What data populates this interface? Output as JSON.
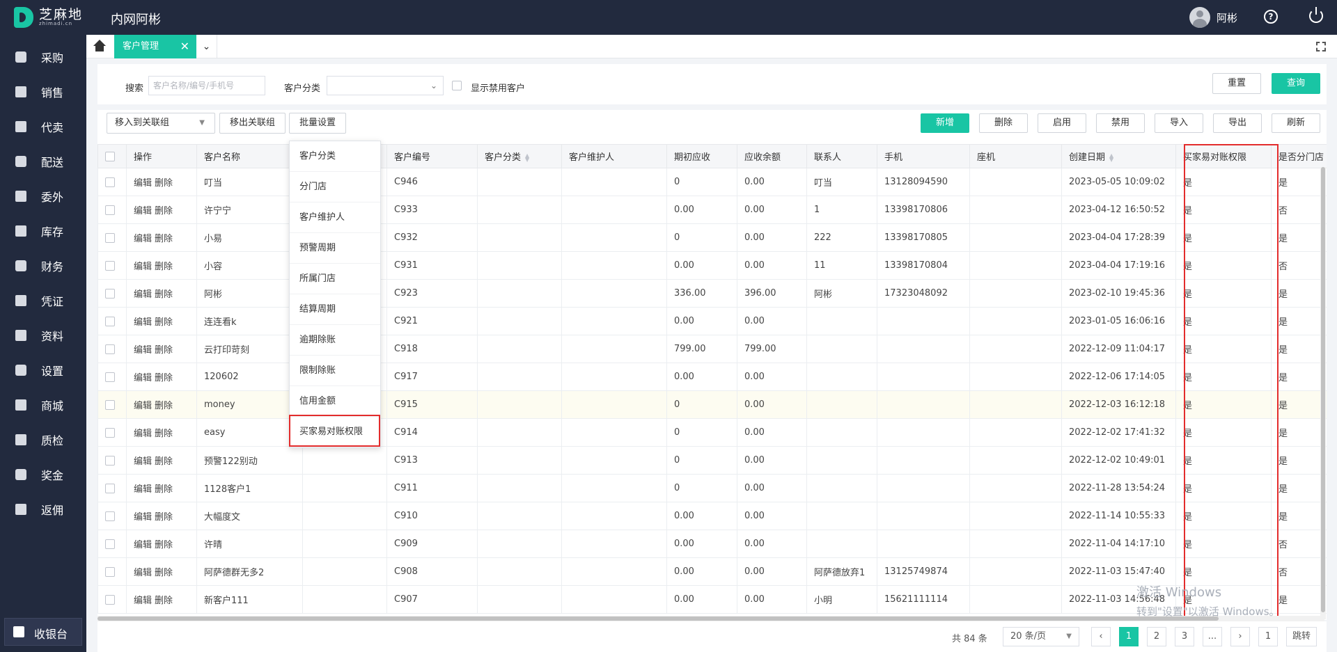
{
  "app": {
    "logo_main": "芝麻地",
    "logo_sub": "zhimadi.cn",
    "title": "内网阿彬",
    "user": "阿彬",
    "help": "?"
  },
  "sidebar": {
    "items": [
      {
        "label": "采购",
        "icon": "basket-icon"
      },
      {
        "label": "销售",
        "icon": "cart-icon"
      },
      {
        "label": "代卖",
        "icon": "tag-icon"
      },
      {
        "label": "配送",
        "icon": "truck-icon"
      },
      {
        "label": "委外",
        "icon": "building-icon"
      },
      {
        "label": "库存",
        "icon": "warehouse-icon"
      },
      {
        "label": "财务",
        "icon": "yen-icon"
      },
      {
        "label": "凭证",
        "icon": "voucher-icon"
      },
      {
        "label": "资料",
        "icon": "database-icon"
      },
      {
        "label": "设置",
        "icon": "gear-icon"
      },
      {
        "label": "商城",
        "icon": "store-icon"
      },
      {
        "label": "质检",
        "icon": "inspect-icon"
      },
      {
        "label": "奖金",
        "icon": "bonus-icon"
      },
      {
        "label": "返佣",
        "icon": "rebate-icon"
      }
    ],
    "checkout": "收银台"
  },
  "tabs": {
    "active": "客户管理",
    "close": "✕",
    "more": "⌄"
  },
  "filter": {
    "search_label": "搜索",
    "search_placeholder": "客户名称/编号/手机号",
    "category_label": "客户分类",
    "show_disabled": "显示禁用客户",
    "reset": "重置",
    "query": "查询"
  },
  "toolbar": {
    "move_to_group": "移入到关联组",
    "remove_from_group": "移出关联组",
    "batch_settings": "批量设置",
    "add": "新增",
    "delete": "删除",
    "enable": "启用",
    "disable": "禁用",
    "import": "导入",
    "export": "导出",
    "refresh": "刷新"
  },
  "batch_menu": [
    "客户分类",
    "分门店",
    "客户维护人",
    "预警周期",
    "所属门店",
    "结算周期",
    "逾期除账",
    "限制除账",
    "信用金额",
    "买家易对账权限"
  ],
  "table": {
    "headers": [
      "操作",
      "客户名称",
      "",
      "客户编号",
      "客户分类",
      "客户维护人",
      "期初应收",
      "应收余额",
      "联系人",
      "手机",
      "座机",
      "创建日期",
      "买家易对账权限",
      "是否分门店"
    ],
    "edit": "编辑",
    "del": "删除",
    "rows": [
      {
        "name": "叮当",
        "code": "C946",
        "init": "0",
        "balance": "0.00",
        "contact": "叮当",
        "phone": "13128094590",
        "date": "2023-05-05 10:09:02",
        "perm": "是",
        "branch": "是"
      },
      {
        "name": "许宁宁",
        "code": "C933",
        "init": "0.00",
        "balance": "0.00",
        "contact": "1",
        "phone": "13398170806",
        "date": "2023-04-12 16:50:52",
        "perm": "是",
        "branch": "否"
      },
      {
        "name": "小易",
        "code": "C932",
        "init": "0",
        "balance": "0.00",
        "contact": "222",
        "phone": "13398170805",
        "date": "2023-04-04 17:28:39",
        "perm": "是",
        "branch": "是"
      },
      {
        "name": "小容",
        "code": "C931",
        "init": "0.00",
        "balance": "0.00",
        "contact": "11",
        "phone": "13398170804",
        "date": "2023-04-04 17:19:16",
        "perm": "是",
        "branch": "否"
      },
      {
        "name": "阿彬",
        "code": "C923",
        "init": "336.00",
        "balance": "396.00",
        "contact": "阿彬",
        "phone": "17323048092",
        "date": "2023-02-10 19:45:36",
        "perm": "是",
        "branch": "是"
      },
      {
        "name": "连连看k",
        "code": "C921",
        "init": "0.00",
        "balance": "0.00",
        "contact": "",
        "phone": "",
        "date": "2023-01-05 16:06:16",
        "perm": "是",
        "branch": "是"
      },
      {
        "name": "云打印苛刻",
        "code": "C918",
        "init": "799.00",
        "balance": "799.00",
        "contact": "",
        "phone": "",
        "date": "2022-12-09 11:04:17",
        "perm": "是",
        "branch": "是"
      },
      {
        "name": "120602",
        "code": "C917",
        "init": "0.00",
        "balance": "0.00",
        "contact": "",
        "phone": "",
        "date": "2022-12-06 17:14:05",
        "perm": "是",
        "branch": "是"
      },
      {
        "name": "money",
        "code": "C915",
        "init": "0",
        "balance": "0.00",
        "contact": "",
        "phone": "",
        "date": "2022-12-03 16:12:18",
        "perm": "是",
        "branch": "是"
      },
      {
        "name": "easy",
        "code": "C914",
        "init": "0",
        "balance": "0.00",
        "contact": "",
        "phone": "",
        "date": "2022-12-02 17:41:32",
        "perm": "是",
        "branch": "是"
      },
      {
        "name": "预警122别动",
        "code": "C913",
        "init": "0",
        "balance": "0.00",
        "contact": "",
        "phone": "",
        "date": "2022-12-02 10:49:01",
        "perm": "是",
        "branch": "是"
      },
      {
        "name": "1128客户1",
        "code": "C911",
        "init": "0",
        "balance": "0.00",
        "contact": "",
        "phone": "",
        "date": "2022-11-28 13:54:24",
        "perm": "是",
        "branch": "是"
      },
      {
        "name": "大幅度文",
        "code": "C910",
        "init": "0.00",
        "balance": "0.00",
        "contact": "",
        "phone": "",
        "date": "2022-11-14 10:55:33",
        "perm": "是",
        "branch": "是"
      },
      {
        "name": "许晴",
        "code": "C909",
        "init": "0.00",
        "balance": "0.00",
        "contact": "",
        "phone": "",
        "date": "2022-11-04 14:17:10",
        "perm": "是",
        "branch": "否"
      },
      {
        "name": "阿萨德群无多2",
        "code": "C908",
        "init": "0.00",
        "balance": "0.00",
        "contact": "阿萨德放弃1",
        "phone": "13125749874",
        "date": "2022-11-03 15:47:40",
        "perm": "是",
        "branch": "否"
      },
      {
        "name": "新客户111",
        "code": "C907",
        "init": "0.00",
        "balance": "0.00",
        "contact": "小明",
        "phone": "15621111114",
        "date": "2022-11-03 14:56:48",
        "perm": "是",
        "branch": "是"
      }
    ]
  },
  "pager": {
    "total": "共 84 条",
    "size": "20 条/页",
    "pages": [
      "1",
      "2",
      "3",
      "..."
    ],
    "prev": "‹",
    "next": "›",
    "jump_value": "1",
    "jump": "跳转"
  },
  "watermark": {
    "line1": "激活 Windows",
    "line2": "转到\"设置\"以激活 Windows。"
  },
  "colors": {
    "accent": "#19c5a4",
    "sidebar": "#222a3e",
    "highlight_box": "#e32c2c"
  }
}
